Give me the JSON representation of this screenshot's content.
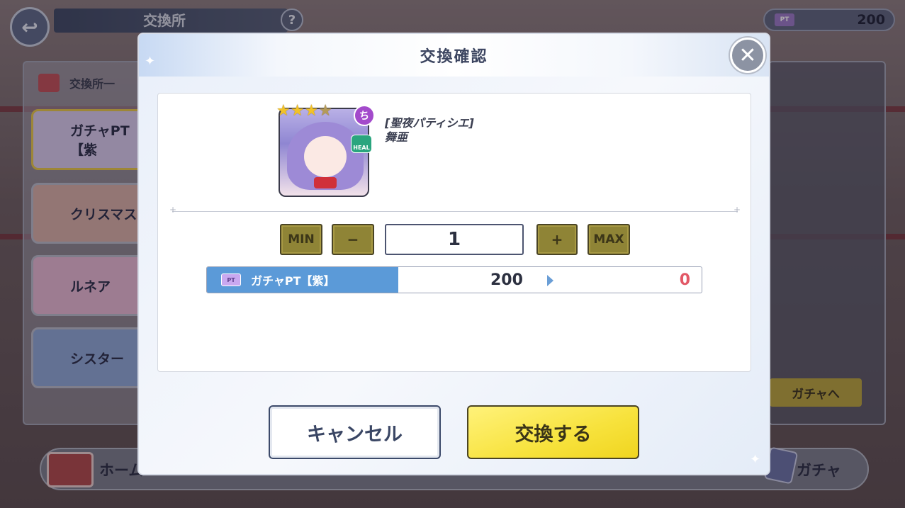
{
  "background": {
    "top_bar": {
      "title": "交換所",
      "help_label": "?",
      "back_label": "↩",
      "currency_value": "200",
      "currency_ticket_label": "PT"
    },
    "left_panel": {
      "header": "交換所一",
      "items": [
        {
          "label": "ガチャPT【紫"
        },
        {
          "label": "クリスマス"
        },
        {
          "label": "ルネア"
        },
        {
          "label": "シスター"
        }
      ]
    },
    "right_panel": {
      "gacha_button_label": "ガチャへ"
    },
    "bottom_nav": {
      "home_label": "ホーム",
      "gacha_label": "ガチャ"
    }
  },
  "dialog": {
    "title": "交換確認",
    "close_label": "✕",
    "item": {
      "name_line1": "[聖夜パティシエ]",
      "name_line2": "舞亜",
      "rarity_filled": 3,
      "rarity_total": 4,
      "attribute_badge": "ち",
      "role_badge": "HEAL"
    },
    "quantity": {
      "min_label": "MIN",
      "minus_label": "−",
      "value": "1",
      "plus_label": "+",
      "max_label": "MAX"
    },
    "cost": {
      "currency_name": "ガチャPT【紫】",
      "ticket_label": "PT",
      "have": "200",
      "after": "0"
    },
    "buttons": {
      "cancel": "キャンセル",
      "confirm": "交換する"
    }
  },
  "colors": {
    "accent_blue": "#5b9ad8",
    "confirm_yellow": "#f7e23c",
    "stepper_olive": "#8f8436",
    "after_red": "#e25866"
  }
}
